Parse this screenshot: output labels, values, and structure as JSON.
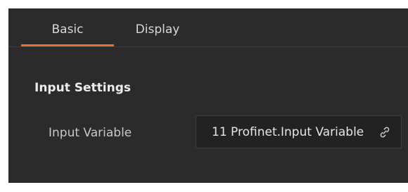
{
  "tabs": [
    {
      "label": "Basic",
      "active": true
    },
    {
      "label": "Display",
      "active": false
    }
  ],
  "accent_color": "#e8702a",
  "section": {
    "title": "Input Settings"
  },
  "fields": {
    "input_variable": {
      "label": "Input Variable",
      "value": "11 Profinet.Input Variable",
      "icon": "link-icon"
    }
  }
}
